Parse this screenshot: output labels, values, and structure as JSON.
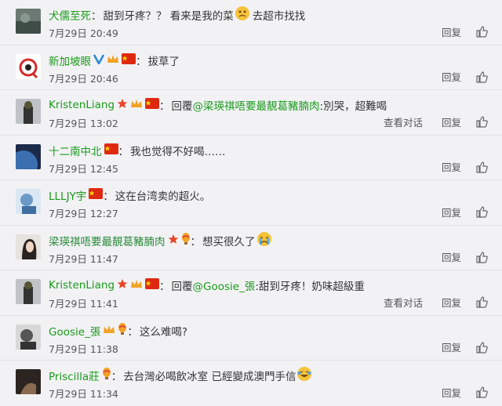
{
  "comments": [
    {
      "name": "犬儒至死",
      "sep": "：",
      "text": "甜到牙疼？？ 看来是我的菜",
      "text2": "去超市找找",
      "time": "7月29日 20:49",
      "has_chat": false
    },
    {
      "name": "新加坡眼",
      "sep": "：",
      "text": "拔草了",
      "time": "7月29日 20:46",
      "has_chat": false
    },
    {
      "name": "KristenLiang",
      "sep": "：",
      "reply_prefix": "回覆",
      "mention": "@梁瑛祺唔要最靚葛豬腩肉",
      "text": ":別哭，超難喝",
      "time": "7月29日 13:02",
      "has_chat": true
    },
    {
      "name": "十二南中北",
      "sep": "：",
      "text": "我也觉得不好喝……",
      "time": "7月29日 12:45",
      "has_chat": false
    },
    {
      "name": "LLLJY宇",
      "sep": "：",
      "text": "这在台湾卖的超火。",
      "time": "7月29日 12:27",
      "has_chat": false
    },
    {
      "name": "梁瑛祺唔要最靚葛豬腩肉",
      "sep": "：",
      "text": "想买很久了",
      "time": "7月29日 11:47",
      "has_chat": false
    },
    {
      "name": "KristenLiang",
      "sep": "：",
      "reply_prefix": "回覆",
      "mention": "@Goosie_張",
      "text": ":甜到牙疼！奶味超級重",
      "time": "7月29日 11:41",
      "has_chat": true
    },
    {
      "name": "Goosie_張",
      "sep": "：",
      "text": "这么难喝?",
      "time": "7月29日 11:38",
      "has_chat": false
    },
    {
      "name": "Priscilla莊",
      "sep": "：",
      "text": "去台灣必喝飲冰室 已經變成澳門手信",
      "time": "7月29日 11:34",
      "has_chat": false
    }
  ],
  "labels": {
    "reply": "回复",
    "view_chat": "查看对话"
  },
  "colors": {
    "name_green": "#1a9a1a",
    "background": "#f2f2f5",
    "divider": "#e3e3e6"
  },
  "icons": [
    "thumbs-up-icon",
    "china-flag-icon",
    "verified-v-icon",
    "vip-crown-icon",
    "star-icon",
    "balloon-icon",
    "emoji-icon"
  ]
}
